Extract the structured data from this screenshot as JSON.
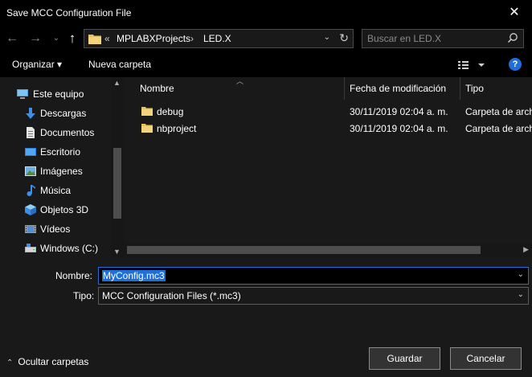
{
  "window": {
    "title": "Save MCC Configuration File",
    "close_glyph": "✕"
  },
  "nav": {
    "back_glyph": "←",
    "forward_glyph": "→",
    "recent_glyph": "⌄",
    "up_glyph": "↑",
    "address": {
      "overflow": "«",
      "crumbs": [
        "MPLABXProjects",
        "LED.X"
      ],
      "separator": "›",
      "dropdown_glyph": "⌄",
      "refresh_glyph": "↻"
    },
    "search": {
      "placeholder": "Buscar en LED.X",
      "icon": "search-icon"
    }
  },
  "toolbar": {
    "organize": "Organizar ▾",
    "new_folder": "Nueva carpeta",
    "help_glyph": "?"
  },
  "sidebar": {
    "items": [
      {
        "label": "Este equipo",
        "icon": "computer-icon"
      },
      {
        "label": "Descargas",
        "icon": "download-icon"
      },
      {
        "label": "Documentos",
        "icon": "document-icon"
      },
      {
        "label": "Escritorio",
        "icon": "desktop-icon"
      },
      {
        "label": "Imágenes",
        "icon": "pictures-icon"
      },
      {
        "label": "Música",
        "icon": "music-icon"
      },
      {
        "label": "Objetos 3D",
        "icon": "cube-icon"
      },
      {
        "label": "Vídeos",
        "icon": "video-icon"
      },
      {
        "label": "Windows (C:)",
        "icon": "drive-icon"
      }
    ]
  },
  "files": {
    "columns": {
      "name": "Nombre",
      "date": "Fecha de modificación",
      "type": "Tipo"
    },
    "rows": [
      {
        "name": "debug",
        "date": "30/11/2019 02:04 a. m.",
        "type": "Carpeta de archivos"
      },
      {
        "name": "nbproject",
        "date": "30/11/2019 02:04 a. m.",
        "type": "Carpeta de archivos"
      }
    ]
  },
  "form": {
    "name_label": "Nombre:",
    "name_value": "MyConfig.mc3",
    "type_label": "Tipo:",
    "type_value": "MCC Configuration Files (*.mc3)",
    "dropdown_glyph": "⌄"
  },
  "footer": {
    "hide_folders": "Ocultar carpetas",
    "hide_glyph": "⌃",
    "save": "Guardar",
    "cancel": "Cancelar"
  },
  "colors": {
    "accent": "#1e6fd9",
    "folder": "#e8c15a",
    "background": "#000000",
    "panel": "#191919"
  }
}
